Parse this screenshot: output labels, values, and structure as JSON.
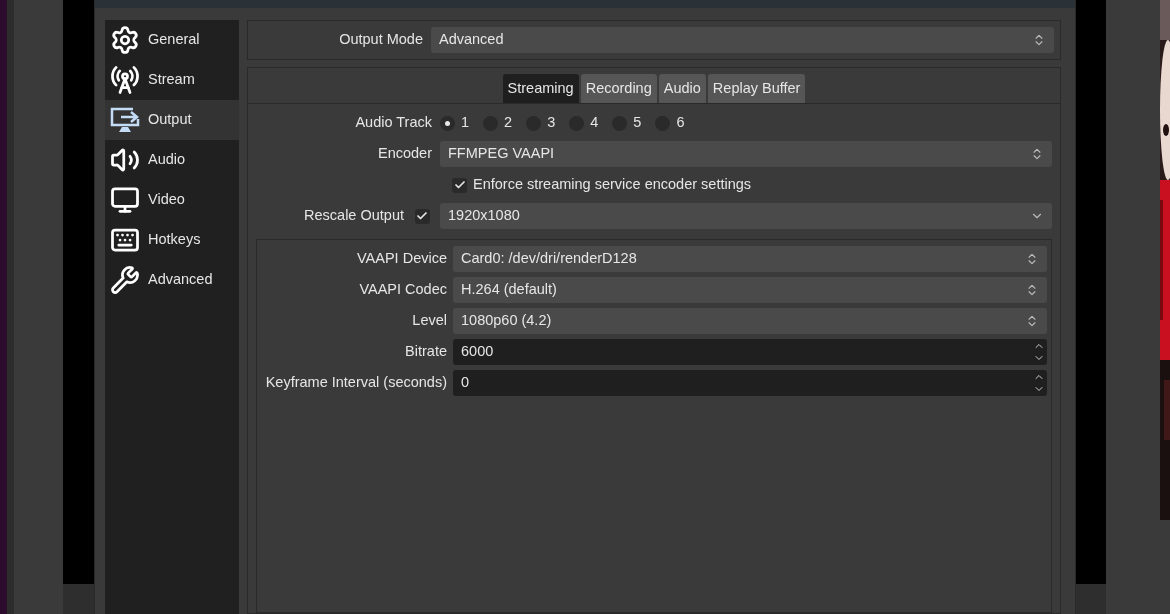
{
  "sidebar": {
    "items": [
      {
        "label": "General",
        "selected": false
      },
      {
        "label": "Stream",
        "selected": false
      },
      {
        "label": "Output",
        "selected": true
      },
      {
        "label": "Audio",
        "selected": false
      },
      {
        "label": "Video",
        "selected": false
      },
      {
        "label": "Hotkeys",
        "selected": false
      },
      {
        "label": "Advanced",
        "selected": false
      }
    ]
  },
  "output_mode": {
    "label": "Output Mode",
    "value": "Advanced"
  },
  "tabs": [
    {
      "label": "Streaming",
      "selected": true
    },
    {
      "label": "Recording",
      "selected": false
    },
    {
      "label": "Audio",
      "selected": false
    },
    {
      "label": "Replay Buffer",
      "selected": false
    }
  ],
  "audio_track": {
    "label": "Audio Track",
    "options": [
      {
        "label": "1",
        "selected": true
      },
      {
        "label": "2",
        "selected": false
      },
      {
        "label": "3",
        "selected": false
      },
      {
        "label": "4",
        "selected": false
      },
      {
        "label": "5",
        "selected": false
      },
      {
        "label": "6",
        "selected": false
      }
    ]
  },
  "encoder": {
    "label": "Encoder",
    "value": "FFMPEG VAAPI"
  },
  "enforce": {
    "label": "Enforce streaming service encoder settings",
    "checked": true
  },
  "rescale": {
    "label": "Rescale Output",
    "checked": true,
    "value": "1920x1080"
  },
  "encoder_settings": [
    {
      "kind": "select",
      "label": "VAAPI Device",
      "value": "Card0: /dev/dri/renderD128"
    },
    {
      "kind": "select",
      "label": "VAAPI Codec",
      "value": "H.264 (default)"
    },
    {
      "kind": "select",
      "label": "Level",
      "value": "1080p60 (4.2)"
    },
    {
      "kind": "spin",
      "label": "Bitrate",
      "value": "6000"
    },
    {
      "kind": "spin",
      "label": "Keyframe Interval (seconds)",
      "value": "0"
    }
  ]
}
